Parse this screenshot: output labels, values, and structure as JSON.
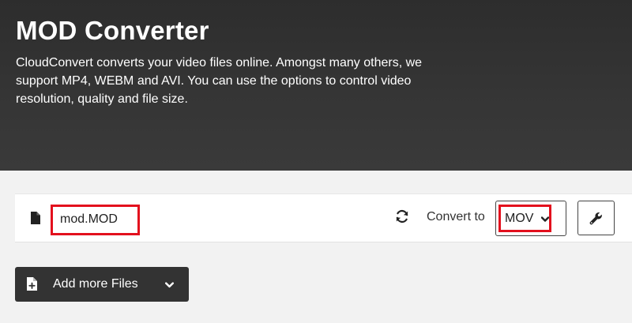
{
  "hero": {
    "title": "MOD Converter",
    "description": "CloudConvert converts your video files online. Amongst many others, we support MP4, WEBM and AVI. You can use the options to control video resolution, quality and file size."
  },
  "file_row": {
    "filename": "mod.MOD",
    "file_icon": "file-icon",
    "refresh_icon": "refresh-icon",
    "convert_label": "Convert to",
    "format_value": "MOV",
    "format_chevron": "chevron-down-icon",
    "settings_icon": "wrench-icon"
  },
  "add_files": {
    "label": "Add more Files",
    "icon": "file-plus-icon",
    "chevron": "chevron-down-icon"
  },
  "colors": {
    "hero_bg": "#2d2d2d",
    "highlight": "#e3101d",
    "button_dark": "#333333"
  }
}
